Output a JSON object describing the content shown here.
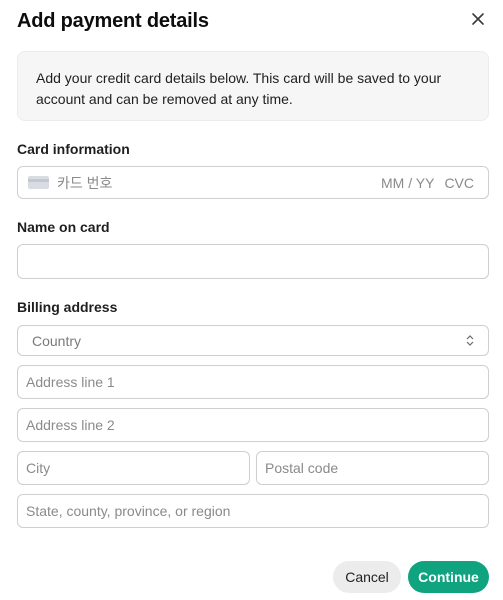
{
  "dialog": {
    "title": "Add payment details",
    "info": "Add your credit card details below. This card will be saved to your account and can be removed at any time."
  },
  "card": {
    "label": "Card information",
    "number_placeholder": "카드 번호",
    "expiry_placeholder": "MM / YY",
    "cvc_placeholder": "CVC"
  },
  "name": {
    "label": "Name on card",
    "value": ""
  },
  "billing": {
    "label": "Billing address",
    "country_placeholder": "Country",
    "address1_placeholder": "Address line 1",
    "address2_placeholder": "Address line 2",
    "city_placeholder": "City",
    "postal_placeholder": "Postal code",
    "state_placeholder": "State, county, province, or region"
  },
  "actions": {
    "cancel_label": "Cancel",
    "continue_label": "Continue"
  },
  "colors": {
    "accent": "#10a37f",
    "info_bg": "#f6f6f6",
    "border": "#cfcfcf"
  },
  "icons": {
    "close": "close-icon",
    "card": "credit-card-icon",
    "select": "chevron-updown-icon"
  }
}
